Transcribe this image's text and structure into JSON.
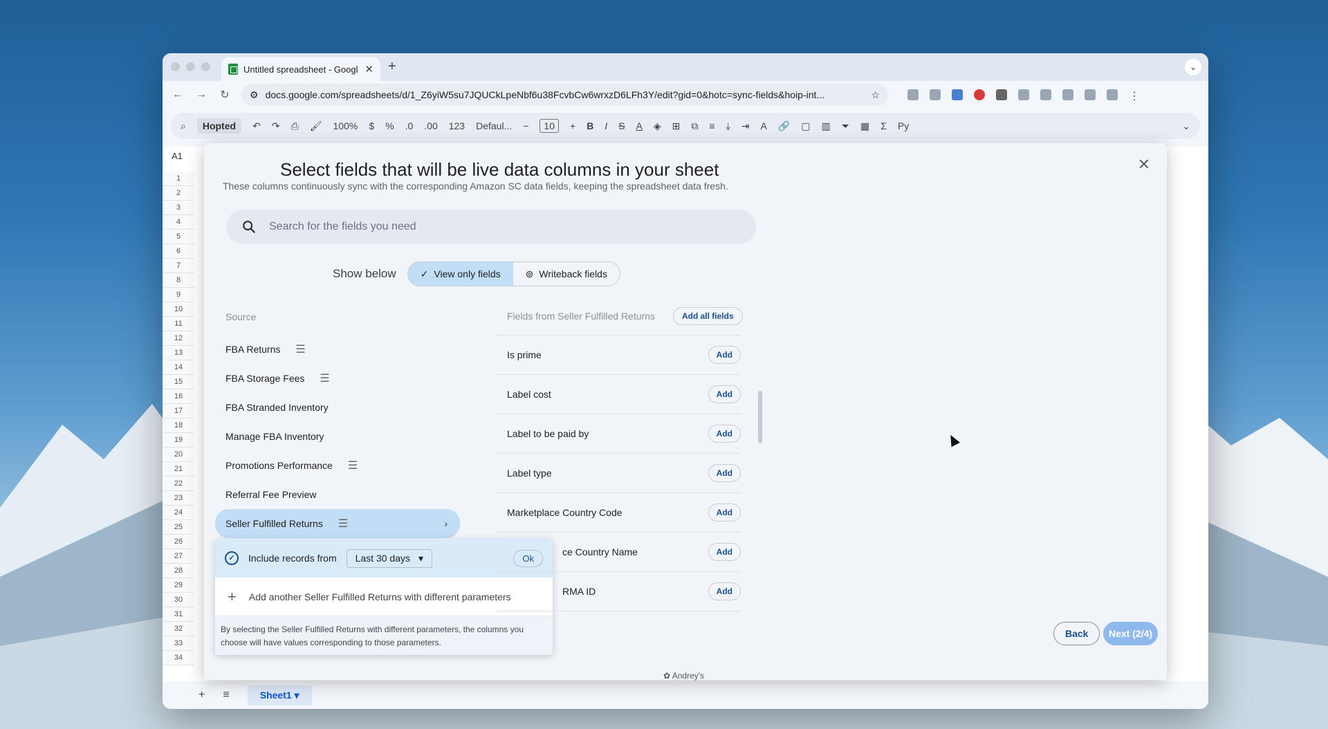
{
  "browser": {
    "tab_title": "Untitled spreadsheet - Googl",
    "url": "docs.google.com/spreadsheets/d/1_Z6yiW5su7JQUCkLpeNbf6u38FcvbCw6wrxzD6LFh3Y/edit?gid=0&hotc=sync-fields&hoip-int..."
  },
  "sheets": {
    "toolbar_brand": "Hopted",
    "zoom": "100%",
    "font": "Defaul...",
    "font_size": "10",
    "name_box": "A1",
    "sheet_tab": "Sheet1",
    "rows": [
      "1",
      "2",
      "3",
      "4",
      "5",
      "6",
      "7",
      "8",
      "9",
      "10",
      "11",
      "12",
      "13",
      "14",
      "15",
      "16",
      "17",
      "18",
      "19",
      "20",
      "21",
      "22",
      "23",
      "24",
      "25",
      "26",
      "27",
      "28",
      "29",
      "30",
      "31",
      "32",
      "33",
      "34"
    ]
  },
  "modal": {
    "title": "Select fields that will be live data columns in your sheet",
    "subtitle": "These columns continuously sync with the corresponding Amazon SC data fields, keeping the spreadsheet data fresh.",
    "search_placeholder": "Search for the fields you need",
    "show_below_label": "Show below",
    "toggle_view_only": "View only fields",
    "toggle_writeback": "Writeback fields",
    "source_label": "Source",
    "sources": [
      {
        "label": "FBA Returns"
      },
      {
        "label": "FBA Storage Fees"
      },
      {
        "label": "FBA Stranded Inventory"
      },
      {
        "label": "Manage FBA Inventory"
      },
      {
        "label": "Promotions Performance"
      },
      {
        "label": "Referral Fee Preview"
      },
      {
        "label": "Seller Fulfilled Returns"
      }
    ],
    "popup": {
      "include_label": "Include records from",
      "range_value": "Last 30 days",
      "ok_label": "Ok",
      "add_another": "Add another Seller Fulfilled Returns with different parameters",
      "note": "By selecting the Seller Fulfilled Returns with different parameters, the columns you choose will have values corresponding to those parameters."
    },
    "fields_header": "Fields from Seller Fulfilled Returns",
    "add_all_label": "Add all fields",
    "fields": [
      {
        "name": "Is prime",
        "action": "Add"
      },
      {
        "name": "Label cost",
        "action": "Add"
      },
      {
        "name": "Label to be paid by",
        "action": "Add"
      },
      {
        "name": "Label type",
        "action": "Add"
      },
      {
        "name": "Marketplace Country Code",
        "action": "Add"
      },
      {
        "name": "ce Country Name",
        "action": "Add"
      },
      {
        "name": "RMA ID",
        "action": "Add"
      }
    ],
    "back_label": "Back",
    "next_label": "Next (2/4)",
    "footer": "Andrey's"
  }
}
